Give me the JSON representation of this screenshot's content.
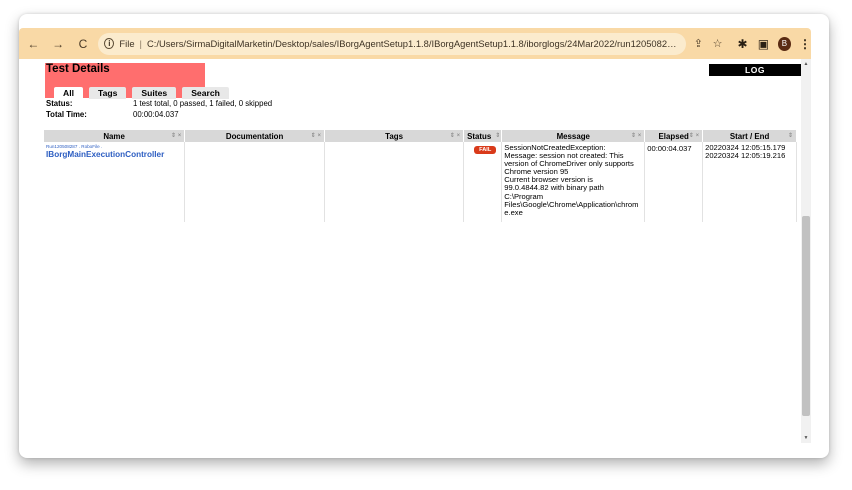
{
  "browser": {
    "back_icon": "arrow-left-icon",
    "forward_icon": "arrow-right-icon",
    "reload_icon": "reload-icon",
    "omnibox": {
      "info_icon": "info-icon",
      "scheme_label": "File",
      "url": "C:/Users/SirmaDigitalMarketin/Desktop/sales/IBorgAgentSetup1.1.8/IBorgAgentSetup1.1.8/iborglogs/24Mar2022/run120508287/IBorgReport...."
    },
    "share_icon": "share-icon",
    "star_icon": "star-icon",
    "extensions_icon": "puzzle-icon",
    "sidepanel_icon": "sidepanel-icon",
    "profile_initial": "B",
    "menu_icon": "kebab-menu-icon"
  },
  "report": {
    "title": "Test Details",
    "tabs": [
      "All",
      "Tags",
      "Suites",
      "Search"
    ],
    "log_label": "LOG",
    "status_label": "Status:",
    "status_value": "1 test total, 0 passed, 1 failed, 0 skipped",
    "total_time_label": "Total Time:",
    "total_time_value": "00:00:04.037",
    "columns": [
      "Name",
      "Documentation",
      "Tags",
      "Status",
      "Message",
      "Elapsed",
      "Start / End"
    ],
    "sort_glyph": "⇕ ×",
    "rows": [
      {
        "parent": "Run120508287 . RoboFile .",
        "name": "IBorgMainExecutionController",
        "documentation": "",
        "tags": "",
        "status": "FAIL",
        "message_lines": [
          "SessionNotCreatedException:",
          "Message: session not created: This",
          "version of ChromeDriver only supports",
          "Chrome version 95",
          "Current browser version is",
          "99.0.4844.82 with binary path",
          "C:\\Program",
          "Files\\Google\\Chrome\\Application\\chrom",
          "e.exe"
        ],
        "elapsed": "00:00:04.037",
        "start": "20220324 12:05:15.179",
        "end": "20220324 12:05:19.216"
      }
    ]
  },
  "colors": {
    "toolbar": "#f9d9a6",
    "header_fail": "#ff6e6e",
    "fail_badge": "#d93a1a",
    "link": "#2d5ec2"
  }
}
